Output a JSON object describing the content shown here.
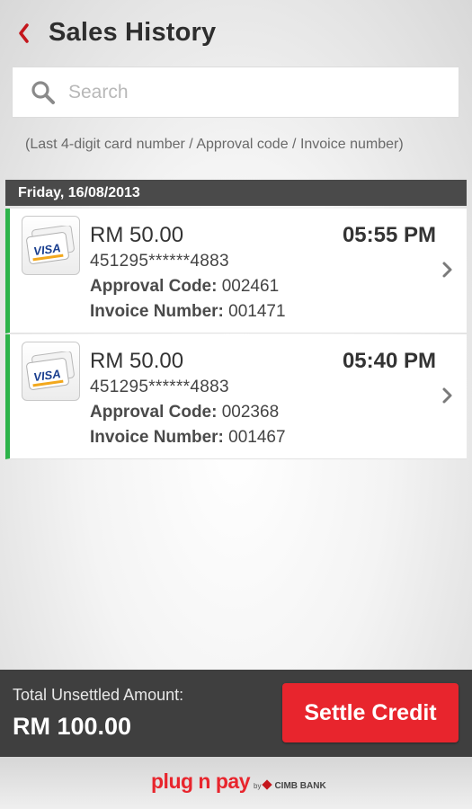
{
  "header": {
    "title": "Sales History",
    "back_icon": "chevron-left-icon"
  },
  "search": {
    "placeholder": "Search",
    "value": "",
    "hint": "(Last 4-digit card number / Approval code / Invoice number)"
  },
  "date_group": "Friday, 16/08/2013",
  "transactions": [
    {
      "amount": "RM 50.00",
      "time": "05:55 PM",
      "card_number": "451295******4883",
      "approval_label": "Approval Code:",
      "approval_code": "002461",
      "invoice_label": "Invoice Number:",
      "invoice_number": "001471",
      "card_brand": "VISA",
      "status_color": "#2db34a"
    },
    {
      "amount": "RM 50.00",
      "time": "05:40 PM",
      "card_number": "451295******4883",
      "approval_label": "Approval Code:",
      "approval_code": "002368",
      "invoice_label": "Invoice Number:",
      "invoice_number": "001467",
      "card_brand": "VISA",
      "status_color": "#2db34a"
    }
  ],
  "footer_bar": {
    "total_label": "Total Unsettled Amount:",
    "total_value": "RM 100.00",
    "settle_label": "Settle Credit",
    "settle_color": "#e8252d"
  },
  "branding": {
    "product": "plug n pay",
    "by": "by",
    "bank": "CIMB BANK"
  }
}
